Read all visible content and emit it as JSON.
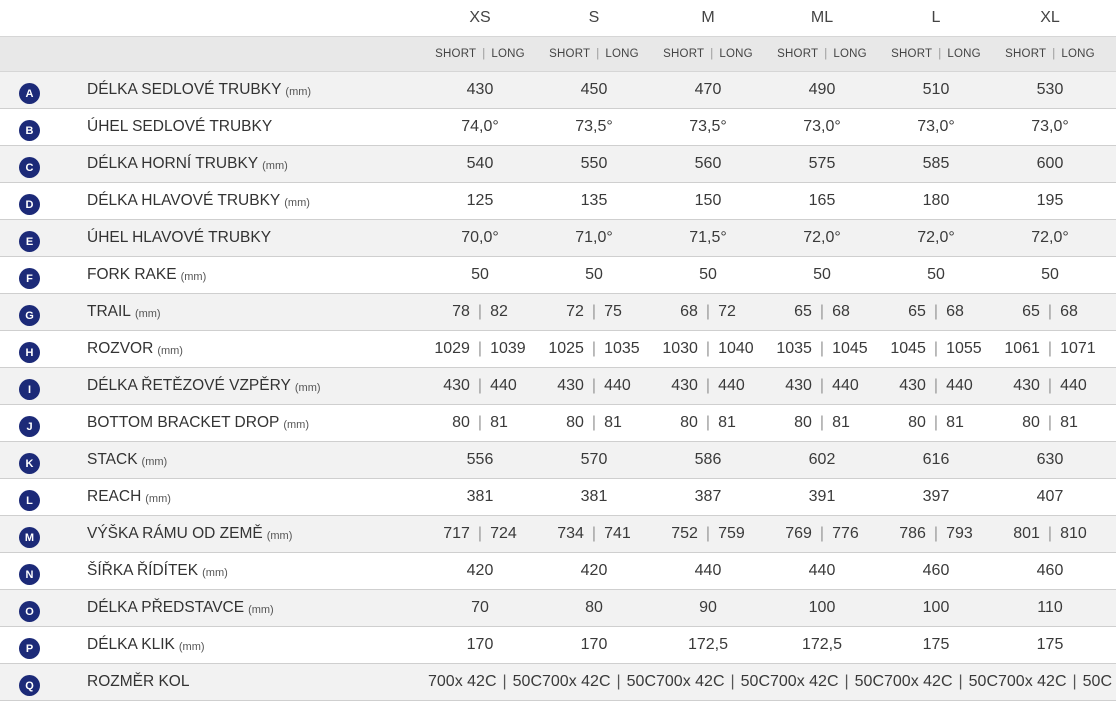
{
  "sizes": [
    "XS",
    "S",
    "M",
    "ML",
    "L",
    "XL"
  ],
  "sub_headers": {
    "short": "SHORT",
    "separator": "|",
    "long": "LONG"
  },
  "rows": [
    {
      "letter": "A",
      "label": "DÉLKA SEDLOVÉ TRUBKY",
      "unit": "(mm)",
      "values": [
        "430",
        "450",
        "470",
        "490",
        "510",
        "530"
      ]
    },
    {
      "letter": "B",
      "label": "ÚHEL SEDLOVÉ TRUBKY",
      "unit": "",
      "values": [
        "74,0°",
        "73,5°",
        "73,5°",
        "73,0°",
        "73,0°",
        "73,0°"
      ]
    },
    {
      "letter": "C",
      "label": "DÉLKA HORNÍ TRUBKY",
      "unit": "(mm)",
      "values": [
        "540",
        "550",
        "560",
        "575",
        "585",
        "600"
      ]
    },
    {
      "letter": "D",
      "label": "DÉLKA HLAVOVÉ TRUBKY",
      "unit": "(mm)",
      "values": [
        "125",
        "135",
        "150",
        "165",
        "180",
        "195"
      ]
    },
    {
      "letter": "E",
      "label": "ÚHEL HLAVOVÉ TRUBKY",
      "unit": "",
      "values": [
        "70,0°",
        "71,0°",
        "71,5°",
        "72,0°",
        "72,0°",
        "72,0°"
      ]
    },
    {
      "letter": "F",
      "label": "FORK RAKE",
      "unit": "(mm)",
      "values": [
        "50",
        "50",
        "50",
        "50",
        "50",
        "50"
      ]
    },
    {
      "letter": "G",
      "label": "TRAIL",
      "unit": "(mm)",
      "split": [
        [
          "78",
          "82"
        ],
        [
          "72",
          "75"
        ],
        [
          "68",
          "72"
        ],
        [
          "65",
          "68"
        ],
        [
          "65",
          "68"
        ],
        [
          "65",
          "68"
        ]
      ]
    },
    {
      "letter": "H",
      "label": "ROZVOR",
      "unit": "(mm)",
      "split": [
        [
          "1029",
          "1039"
        ],
        [
          "1025",
          "1035"
        ],
        [
          "1030",
          "1040"
        ],
        [
          "1035",
          "1045"
        ],
        [
          "1045",
          "1055"
        ],
        [
          "1061",
          "1071"
        ]
      ]
    },
    {
      "letter": "I",
      "label": "DÉLKA ŘETĚZOVÉ VZPĚRY",
      "unit": "(mm)",
      "split": [
        [
          "430",
          "440"
        ],
        [
          "430",
          "440"
        ],
        [
          "430",
          "440"
        ],
        [
          "430",
          "440"
        ],
        [
          "430",
          "440"
        ],
        [
          "430",
          "440"
        ]
      ]
    },
    {
      "letter": "J",
      "label": "BOTTOM BRACKET DROP",
      "unit": "(mm)",
      "split": [
        [
          "80",
          "81"
        ],
        [
          "80",
          "81"
        ],
        [
          "80",
          "81"
        ],
        [
          "80",
          "81"
        ],
        [
          "80",
          "81"
        ],
        [
          "80",
          "81"
        ]
      ]
    },
    {
      "letter": "K",
      "label": "STACK",
      "unit": "(mm)",
      "values": [
        "556",
        "570",
        "586",
        "602",
        "616",
        "630"
      ]
    },
    {
      "letter": "L",
      "label": "REACH",
      "unit": "(mm)",
      "values": [
        "381",
        "381",
        "387",
        "391",
        "397",
        "407"
      ]
    },
    {
      "letter": "M",
      "label": "VÝŠKA RÁMU OD ZEMĚ",
      "unit": "(mm)",
      "split": [
        [
          "717",
          "724"
        ],
        [
          "734",
          "741"
        ],
        [
          "752",
          "759"
        ],
        [
          "769",
          "776"
        ],
        [
          "786",
          "793"
        ],
        [
          "801",
          "810"
        ]
      ]
    },
    {
      "letter": "N",
      "label": "ŠÍŘKA ŘÍDÍTEK",
      "unit": "(mm)",
      "values": [
        "420",
        "420",
        "440",
        "440",
        "460",
        "460"
      ]
    },
    {
      "letter": "O",
      "label": "DÉLKA PŘEDSTAVCE",
      "unit": "(mm)",
      "values": [
        "70",
        "80",
        "90",
        "100",
        "100",
        "110"
      ]
    },
    {
      "letter": "P",
      "label": "DÉLKA KLIK",
      "unit": "(mm)",
      "values": [
        "170",
        "170",
        "172,5",
        "172,5",
        "175",
        "175"
      ]
    },
    {
      "letter": "Q",
      "label": "ROZMĚR KOL",
      "unit": "",
      "wheel": [
        "700x 42C",
        "50C700x 42C",
        "50C700x 42C",
        "50C700x 42C",
        "50C700x 42C",
        "50C700x 42C",
        "50C"
      ]
    }
  ],
  "colors": {
    "badge": "#1c2a78",
    "row_alt": "#f2f2f2",
    "header_band": "#e8e8e8"
  }
}
